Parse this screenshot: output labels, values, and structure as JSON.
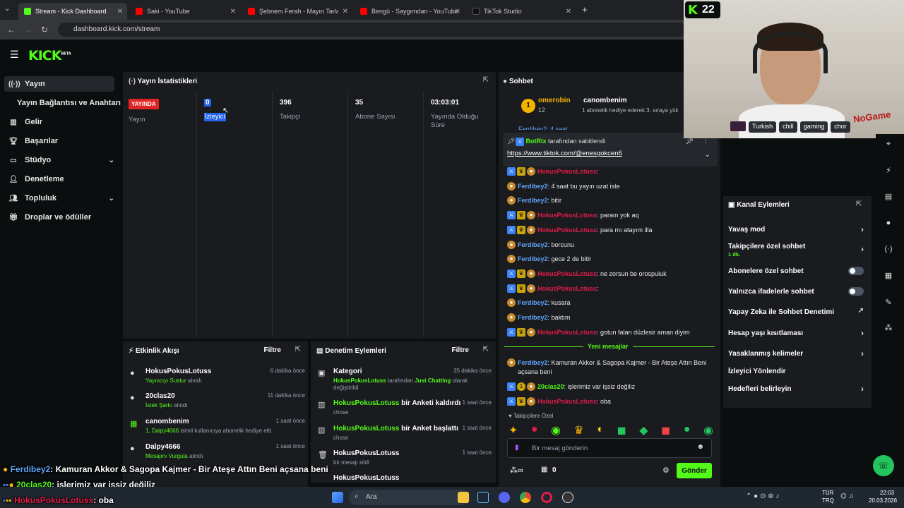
{
  "browser": {
    "tabs": [
      {
        "label": "Stream - Kick Dashboard",
        "active": true
      },
      {
        "label": "Saki - YouTube"
      },
      {
        "label": "Şebnem Ferah - Mayın Tarlası (",
        "active": false
      },
      {
        "label": "Bengü - Saygımdan - YouTube"
      },
      {
        "label": "TikTok Studio"
      }
    ],
    "url": "dashboard.kick.com/stream"
  },
  "logo": {
    "text": "KICK",
    "beta": "BETA"
  },
  "sidebar": {
    "items": [
      {
        "label": "Yayın",
        "icon": "broadcast-icon"
      },
      {
        "label": "Yayın Bağlantısı ve Anahtarı"
      },
      {
        "label": "Gelir",
        "icon": "chart-icon"
      },
      {
        "label": "Başarılar",
        "icon": "trophy-icon"
      },
      {
        "label": "Stüdyo",
        "icon": "monitor-icon"
      },
      {
        "label": "Denetleme",
        "icon": "user-x-icon"
      },
      {
        "label": "Topluluk",
        "icon": "users-icon"
      },
      {
        "label": "Droplar ve ödüller",
        "icon": "gift-icon"
      }
    ]
  },
  "stats": {
    "title": "Yayın İstatistikleri",
    "live_badge": "YAYINDA",
    "live_label": "Yayın",
    "items": [
      {
        "value": "0",
        "label": "İzleyici"
      },
      {
        "value": "396",
        "label": "Takipçi"
      },
      {
        "value": "35",
        "label": "Abone Sayısı"
      },
      {
        "value": "03:03:01",
        "label": "Yayında Olduğu Süre"
      }
    ]
  },
  "activity": {
    "title": "Etkinlik Akışı",
    "filter": "Filtre",
    "items": [
      {
        "name": "HokusPokusLotuss",
        "sub": "Yayıncıyı Sustur",
        "sub2": "alındı",
        "time": "6 dakika önce"
      },
      {
        "name": "20clas20",
        "sub": "İstek Şarkı",
        "sub2": "alındı",
        "time": "11 dakika önce"
      },
      {
        "name": "canombenim",
        "sub": "1, Dalpy4666",
        "sub2": "isimli kullanıcıya abonelik hediye etti.",
        "time": "1 saat önce"
      },
      {
        "name": "Dalpy4666",
        "sub": "Mesajını Vurgula",
        "sub2": "alındı",
        "time": "1 saat önce"
      }
    ]
  },
  "modlog": {
    "title": "Denetim Eylemleri",
    "filter": "Filtre",
    "items": [
      {
        "name": "Kategori",
        "sub_user": "HokusPokusLotuss",
        "sub_mid": "tarafından",
        "sub_cat": "Just Chatting",
        "sub_end": "olarak değiştirildi",
        "time": "35 dakika önce"
      },
      {
        "name_user": "HokusPokusLotuss",
        "name_rest": "bir Anketi kaldırdı",
        "sub": "chose",
        "time": "1 saat önce"
      },
      {
        "name_user": "HokusPokusLotuss",
        "name_rest": "bir Anket başlattı",
        "sub": "chose",
        "time": "1 saat önce"
      },
      {
        "name": "HokusPokusLotuss",
        "sub": "bir mesajı sildi",
        "time": "1 saat önce"
      },
      {
        "name": "HokusPokusLotuss"
      }
    ]
  },
  "chat": {
    "title": "Sohbet",
    "top_gifter": {
      "rank": "1",
      "name": "omerobin",
      "count": "12"
    },
    "gift_user": "canombenim",
    "gift_text": "1 abonelik hediye ederek 3. sıraya yük",
    "pinned_by": "BotRix",
    "pinned_label": "tarafından sabitlendi",
    "pinned_link": "https://www.tiktok.com/@enesgokcen6",
    "cut_line": "Ferdibey2: 4 saat",
    "messages": [
      {
        "user": "HokusPokusLotuss",
        "text": ":",
        "type": "red"
      },
      {
        "user": "Ferdibey2",
        "text": ": 4 saat bu yayın uzat iste",
        "type": "blue"
      },
      {
        "user": "Ferdibey2",
        "text": ": bitir",
        "type": "blue"
      },
      {
        "user": "HokusPokusLotuss",
        "text": ": param yok aq",
        "type": "red"
      },
      {
        "user": "HokusPokusLotuss",
        "text": ": para mı atayım illa",
        "type": "red"
      },
      {
        "user": "Ferdibey2",
        "text": ": borcunu",
        "type": "blue"
      },
      {
        "user": "Ferdibey2",
        "text": ": gece 2 de bitir",
        "type": "blue"
      },
      {
        "user": "HokusPokusLotuss",
        "text": ": ne zorsun be orospuluk",
        "type": "red"
      },
      {
        "user": "HokusPokusLotuss",
        "text": ":",
        "type": "red"
      },
      {
        "user": "Ferdibey2",
        "text": ": kusara",
        "type": "blue"
      },
      {
        "user": "Ferdibey2",
        "text": ": baktım",
        "type": "blue"
      },
      {
        "user": "HokusPokusLotuss",
        "text": ": gotun falan düzlesir aman diyim",
        "type": "red"
      }
    ],
    "new_messages": "Yeni mesajlar",
    "new": [
      {
        "user": "Ferdibey2",
        "text": ": Kamuran Akkor & Sagopa Kajmer - Bir Ateşe Attın Beni",
        "text2": "açsana beni",
        "type": "blue"
      },
      {
        "user": "20clas20",
        "text": ": işlerimiz var işsiz değiliz",
        "type": "green"
      },
      {
        "user": "HokusPokusLotuss",
        "text": ": oba",
        "type": "red"
      }
    ],
    "followers_only": "Takipçilere Özel",
    "input_placeholder": "Bir mesaj gönderin",
    "points": "0",
    "send": "Gönder"
  },
  "actions": {
    "title": "Kanal Eylemleri",
    "items": [
      {
        "label": "Yavaş mod",
        "kind": "arrow"
      },
      {
        "label": "Takipçilere özel sohbet",
        "sub": "1 dk.",
        "kind": "arrow"
      },
      {
        "label": "Abonelere özel sohbet",
        "kind": "toggle"
      },
      {
        "label": "Yalnızca ifadelerle sohbet",
        "kind": "toggle"
      },
      {
        "label": "Yapay Zeka ile Sohbet Denetimi",
        "kind": "ext"
      },
      {
        "label": "Hesap yaşı kısıtlaması",
        "kind": "arrow"
      },
      {
        "label": "Yasaklanmış kelimeler",
        "kind": "arrow"
      },
      {
        "label": "İzleyici Yönlendir",
        "kind": "none"
      },
      {
        "label": "Hedefleri belirleyin",
        "kind": "arrow"
      }
    ]
  },
  "webcam": {
    "count": "22",
    "tags": [
      "Turkish",
      "chill",
      "gaming",
      "chor"
    ],
    "logo_text": "NoGame"
  },
  "overlay": [
    {
      "user": "Ferdibey2",
      "text": ": Kamuran Akkor & Sagopa Kajmer - Bir Ateşe Attın Beni açsana beni"
    },
    {
      "user": "20clas20",
      "text": ": işlerimiz var işsiz değiliz"
    },
    {
      "user": "HokusPokusLotuss",
      "text": ": oba"
    }
  ],
  "taskbar": {
    "search": "Ara",
    "lang": "TÜR",
    "lang2": "TRQ",
    "time": "22:03",
    "date": "20.03.2026"
  },
  "colors": {
    "brand": "#53fc18",
    "panel": "#191b1f",
    "bg": "#0b0e0f"
  }
}
